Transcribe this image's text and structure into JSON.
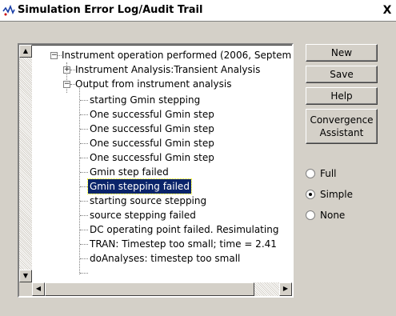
{
  "window": {
    "title": "Simulation Error Log/Audit Trail",
    "close_label": "X"
  },
  "tree": {
    "root": "Instrument operation performed  (2006, Septem",
    "child1": "Instrument Analysis:Transient Analysis",
    "child2": "Output from instrument analysis",
    "items": [
      "starting Gmin stepping",
      "One successful Gmin step",
      "One successful Gmin step",
      "One successful Gmin step",
      "One successful Gmin step",
      "Gmin step failed",
      "Gmin stepping failed",
      "starting source stepping",
      "source stepping failed",
      "DC operating point failed. Resimulating",
      "TRAN:  Timestep too small; time = 2.41",
      "doAnalyses: timestep too small"
    ],
    "selected_index": 6
  },
  "buttons": {
    "new_label": "New",
    "save_label": "Save",
    "help_label": "Help",
    "convergence_line1": "Convergence",
    "convergence_line2": "Assistant"
  },
  "detail_options": {
    "full": "Full",
    "simple": "Simple",
    "none": "None",
    "selected": "Simple"
  }
}
